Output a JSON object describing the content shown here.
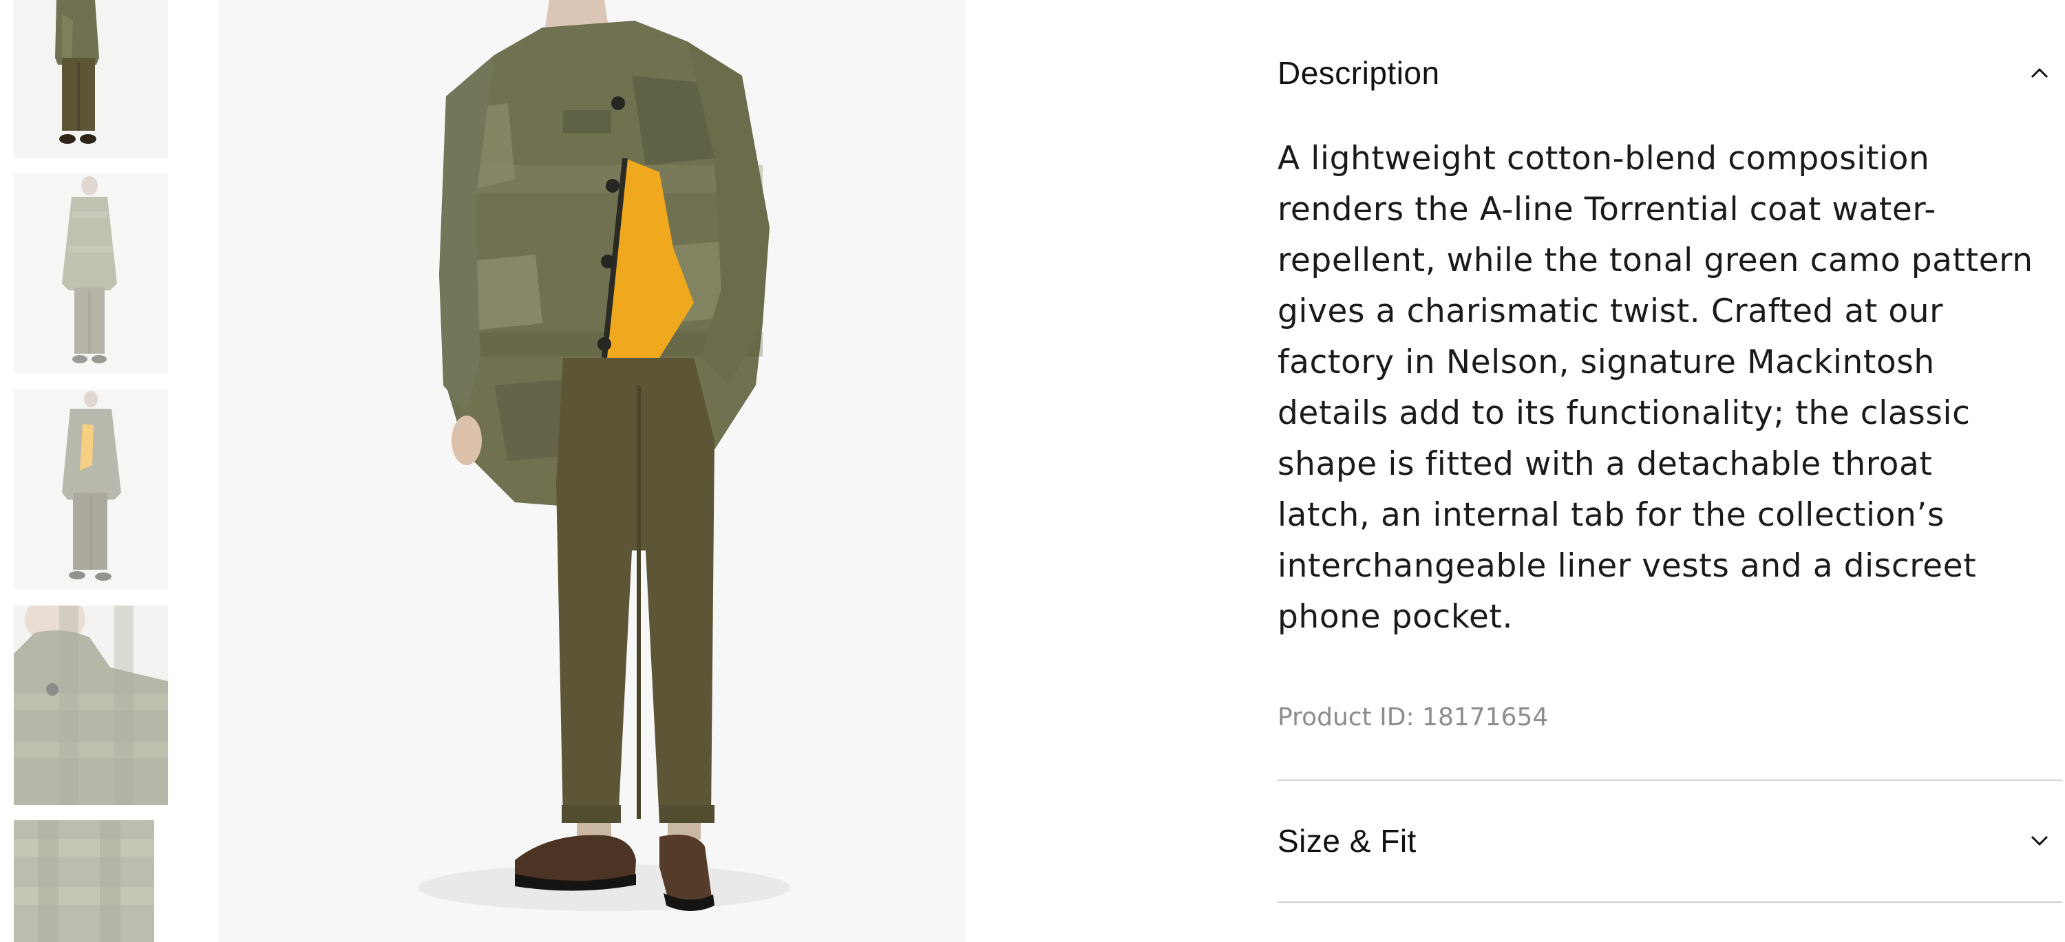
{
  "thumbnails": [
    {
      "name": "full-look-front"
    },
    {
      "name": "full-look-plain-coat"
    },
    {
      "name": "full-look-open-coat"
    },
    {
      "name": "collar-detail"
    },
    {
      "name": "fabric-detail"
    }
  ],
  "main_image": {
    "name": "camo-coat-model"
  },
  "description": {
    "title": "Description",
    "expanded": true,
    "text": "A lightweight cotton-blend composition\nrenders the A-line Torrential coat water-\nrepellent, while the tonal green camo pattern\ngives a charismatic twist. Crafted at our\nfactory in Nelson, signature Mackintosh\ndetails add to its functionality; the classic\nshape is fitted with a detachable throat\nlatch, an internal tab for the collection’s\ninterchangeable liner vests and a discreet\nphone pocket.",
    "product_id": "Product ID: 18171654",
    "toggle_icon": "chevron-up-icon"
  },
  "size_fit": {
    "title": "Size & Fit",
    "expanded": false,
    "toggle_icon": "chevron-down-icon"
  },
  "colors": {
    "coat": "#6f7150",
    "trousers": "#5c5636",
    "liner": "#f0a81e",
    "shoes": "#4b3424",
    "text": "#111111",
    "muted_text": "#8c8c8c"
  }
}
